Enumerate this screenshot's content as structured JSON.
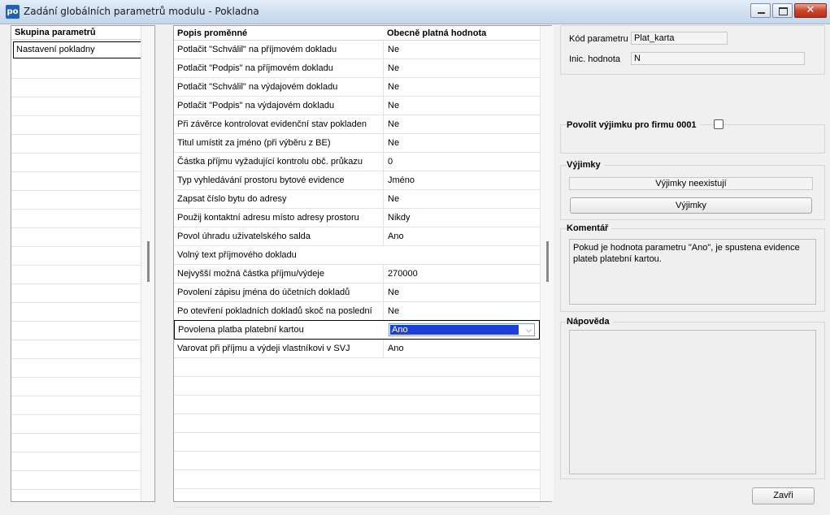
{
  "window": {
    "title": "Zadání globálních parametrů modulu - Pokladna",
    "icon_text": "po",
    "close_glyph": "✕"
  },
  "groups": {
    "header": "Skupina parametrů",
    "items": [
      "Nastavení pokladny"
    ]
  },
  "grid": {
    "col1": "Popis proměnné",
    "col2": "Obecně platná hodnota",
    "rows": [
      {
        "desc": "Potlačit \"Schválil\" na příjmovém dokladu",
        "value": "Ne"
      },
      {
        "desc": "Potlačit \"Podpis\" na příjmovém dokladu",
        "value": "Ne"
      },
      {
        "desc": "Potlačit \"Schválil\" na výdajovém dokladu",
        "value": "Ne"
      },
      {
        "desc": "Potlačit \"Podpis\" na výdajovém dokladu",
        "value": "Ne"
      },
      {
        "desc": "Při závěrce kontrolovat evidenční stav pokladen",
        "value": "Ne"
      },
      {
        "desc": "Titul umístit za jméno (při výběru z BE)",
        "value": "Ne"
      },
      {
        "desc": "Částka příjmu vyžadující kontrolu obč. průkazu",
        "value": "0"
      },
      {
        "desc": "Typ vyhledávání prostoru bytové evidence",
        "value": "Jméno"
      },
      {
        "desc": "Zapsat číslo bytu do adresy",
        "value": "Ne"
      },
      {
        "desc": "Použij kontaktní adresu místo adresy prostoru",
        "value": "Nikdy"
      },
      {
        "desc": "Povol úhradu uživatelského salda",
        "value": "Ano"
      },
      {
        "desc": "Volný text příjmového dokladu",
        "value": ""
      },
      {
        "desc": "Nejvyšší možná částka příjmu/výdeje",
        "value": "270000"
      },
      {
        "desc": "Povolení zápisu jména do účetních dokladů",
        "value": "Ne"
      },
      {
        "desc": "Po otevření pokladních dokladů skoč na poslední",
        "value": "Ne"
      },
      {
        "desc": "Povolena platba platební kartou",
        "value": "Ano",
        "selected": true
      },
      {
        "desc": "Varovat při příjmu a výdeji vlastníkovi v SVJ",
        "value": "Ano"
      }
    ],
    "empty_rows": 8
  },
  "details": {
    "code_label": "Kód parametru",
    "code_value": "Plat_karta",
    "init_label": "Inic. hodnota",
    "init_value": "N",
    "exception_checkbox_label": "Povolit výjimku pro firmu 0001",
    "exceptions_title": "Výjimky",
    "exceptions_status": "Výjimky neexistují",
    "exceptions_button": "Výjimky",
    "comment_title": "Komentář",
    "comment_text": "Pokud je hodnota parametru \"Ano\", je spustena evidence plateb platební kartou.",
    "help_title": "Nápověda",
    "help_text": "",
    "close_button": "Zavři"
  }
}
